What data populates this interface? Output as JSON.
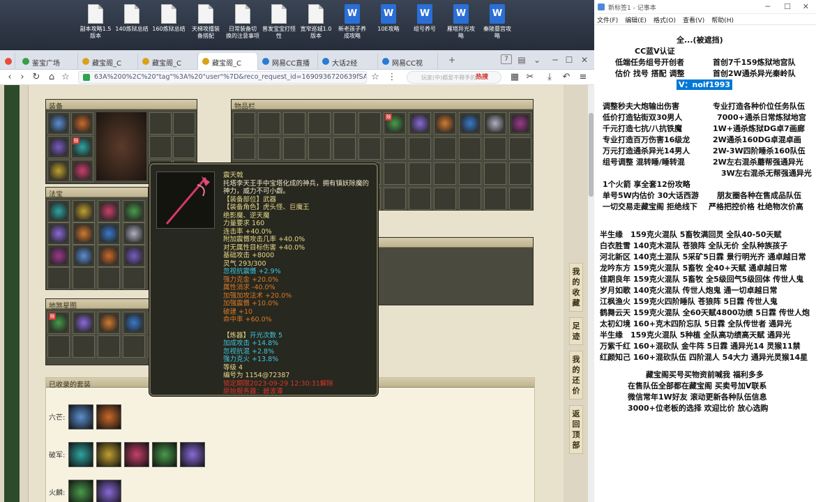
{
  "desktop": {
    "icons": [
      {
        "label": "副本攻略1.5\n版本",
        "type": "file"
      },
      {
        "label": "140炼狱总结",
        "type": "file"
      },
      {
        "label": "160炼狱总结",
        "type": "file"
      },
      {
        "label": "天梯攻擂装\n备搭配",
        "type": "file"
      },
      {
        "label": "日常装备切\n换的注意事项",
        "type": "file"
      },
      {
        "label": "普发宝宝打怪\n性",
        "type": "file"
      },
      {
        "label": "宽窄巡城1.0\n版本",
        "type": "file"
      },
      {
        "label": "新老孩子养\n成攻略",
        "type": "word"
      },
      {
        "label": "10E攻略",
        "type": "word"
      },
      {
        "label": "组号养号",
        "type": "word"
      },
      {
        "label": "雁塔异光攻\n略",
        "type": "word"
      },
      {
        "label": "秦陵墓宫攻\n略",
        "type": "word"
      }
    ]
  },
  "browser": {
    "tabs": [
      {
        "label": "鉴宝广场",
        "active": false
      },
      {
        "label": "藏宝阁_C",
        "active": false
      },
      {
        "label": "藏宝阁_C",
        "active": false
      },
      {
        "label": "藏宝阁_C",
        "active": true
      },
      {
        "label": "网易CC直播",
        "active": false
      },
      {
        "label": "大话2经",
        "active": false
      },
      {
        "label": "网易CC视",
        "active": false
      }
    ],
    "tab_count": "7",
    "url": "63A%200%2C%20\"tag\"%3A%20\"user\"%7D&reco_request_id=1690936720639fSANQ",
    "search_placeholder": "玩家(中)都爱不释手的",
    "hot_label": "热搜"
  },
  "game": {
    "equip_title": "装备",
    "treasure_title": "法宝",
    "holy_title": "地煞星图",
    "items_title": "物品栏",
    "suits_title": "已收录的套装",
    "locked_tag": "限",
    "suits": [
      {
        "label": "六芒:",
        "count": 2
      },
      {
        "label": "破军:",
        "count": 5
      },
      {
        "label": "火麟:",
        "count": 2
      }
    ]
  },
  "tooltip": {
    "name": "震天戟",
    "desc": "托塔李天王手中宝塔化成的神兵，拥有镇妖除魔的神力，威力不可小觑。",
    "slot": "【装备部位】武器",
    "roles": "【装备角色】虎头怪、巨魔王",
    "roles2": "绝影魔、逆天魔",
    "req": "力量要求 160",
    "attrs": [
      "连击率 +40.0%",
      "附加震慑攻击几率 +40.0%",
      "对无属性目标伤害 +40.0%",
      "基础攻击 +8000",
      "灵气 293/300"
    ],
    "special": "忽视抗震慑 +2.9%",
    "orange": [
      "强力克金 +20.0%",
      "属性消求 -40.0%",
      "加强加攻法术 +20.0%",
      "加强震慑 +10.0%",
      "破建 +10",
      "命中率 +60.0%"
    ],
    "refine_head": "【炼器】",
    "refine_val": "开光次数 5",
    "refine": [
      "加成攻击 +14.8%",
      "忽视抗混 +2.8%",
      "强力克火 +13.8%"
    ],
    "level": "等级 4",
    "serial": "编号为 1154@72387",
    "bind": "锁定期限2023-09-29 12:30:31解除",
    "server": "原始服务器：碧波潭"
  },
  "side_buttons": [
    "我的收藏",
    "足迹",
    "我的还价",
    "返回顶部"
  ],
  "notepad": {
    "title": "新标签1 - 记事本",
    "menu": [
      "文件(F)",
      "编辑(E)",
      "格式(O)",
      "查看(V)",
      "帮助(H)"
    ],
    "lines": [
      "全...(被遮挡)",
      "CC蓝V认证",
      "低端任务组号开创者",
      "首创7千159炼狱地宫队",
      "估价 找号 搭配 调整",
      "首创2W通杀异光秦岭队",
      "V：noif1993",
      "调整秒夫大炮输出伤害",
      "专业打造各种价位任务队伍",
      "低价打造钻街双30男人",
      "7000+通杀日常炼狱地宫",
      "千元打造七抗/八抗铁魔",
      "1W+通杀炼狱DG卓7画廊",
      "专业打造百万伤害16级龙",
      "2W通杀160DG卓混卓画",
      "万元打造通杀异光14男人",
      "2W-3W四阶睡杀160队伍",
      "组号调整 混转睡/睡转混",
      "2W左右混杀蘑帮强通异光",
      "3W左右混杀无帮强通异光",
      "1个火箭 享全套12份攻略",
      "单号5W内估价 30大话西游",
      "朋友圈各种在售成品队伍",
      "一切交易走藏宝阁 拒绝线下",
      "严格把控价格 杜绝物次价高",
      "半生缘　159克火混队 5畜牧满回灵 全队40-50天赋",
      "白衣胜雪 140克木混队 苍狼阵 全队无价 全队种族孩子",
      "河北新区 140克土混队 5采矿5日霖 景行明光齐 通卓越日常",
      "龙吟东方 159克火混队 5畜牧 全40+天赋 通卓越日常",
      "佳期良年 159克火混队 5畜牧 全5级回气5级回体 传世人鬼",
      "岁月如歌 140克火混队 传世人炮鬼 通一切卓越日常",
      "江枫渔火 159克火四阶睡队 苍狼阵 5日霖 传世人鬼",
      "鹤舞云天 159克火混队 全60天赋4800功绩 5日霖 传世人炮",
      "太初幻境 160+克木四阶忘队 5日霖 全队传世者 通异光",
      "半生缘　159克火混队 5种植 全队高功绩高天赋 通异光",
      "万紫千红 160+混砍队 金牛阵 5日霖 通异光14 灵猴11禁",
      "红颜知己 160+混砍队伍 四阶混人 54大力 通异光灵猴14星",
      "藏宝阁买号买物资前喊我 福利多多",
      "在售队伍全部都在藏宝阁 买卖号加V联系",
      "微信常年1W好友 滚动更新各种队伍信息",
      "3000+位老板的选择 欢迎比价 放心选购"
    ]
  }
}
